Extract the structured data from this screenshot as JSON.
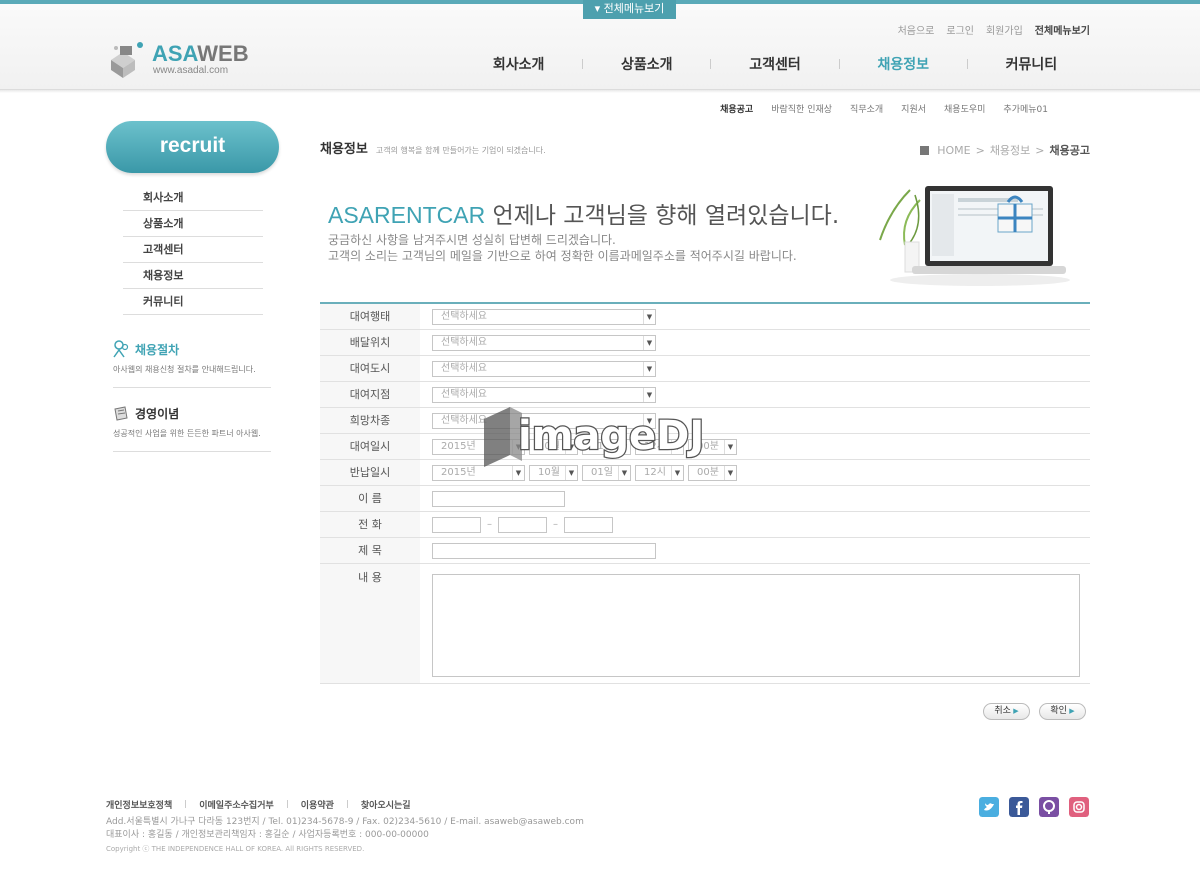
{
  "header": {
    "all_menu_tab": "▾ 전체메뉴보기",
    "logo_text_a": "ASA",
    "logo_text_b": "WEB",
    "logo_url": "www.asadal.com",
    "util": [
      "처음으로",
      "로그인",
      "회원가입",
      "전체메뉴보기"
    ],
    "gnb": [
      "회사소개",
      "상품소개",
      "고객센터",
      "채용정보",
      "커뮤니티"
    ],
    "gnb_active": "채용정보"
  },
  "subnav": [
    "채용공고",
    "바람직한 인재상",
    "직무소개",
    "지원서",
    "채용도우미",
    "추가메뉴01"
  ],
  "sidebar": {
    "title": "recruit",
    "items": [
      "회사소개",
      "상품소개",
      "고객센터",
      "채용정보",
      "커뮤니티"
    ],
    "box1": {
      "title": "채용절차",
      "desc": "아사웹의 채용신청 절차를 안내해드립니다."
    },
    "box2": {
      "title": "경영이념",
      "desc": "성공적인 사업을 위한 든든한 파트너 아사웹."
    }
  },
  "content": {
    "title": "채용정보",
    "subtitle": "고객의 행복을 함께 만들어가는 기업이 되겠습니다.",
    "breadcrumb": {
      "home": "HOME",
      "mid": "채용정보",
      "current": "채용공고",
      "sep": ">"
    },
    "banner": {
      "brand": "ASARENTCAR",
      "headline": " 언제나 고객님을 향해 열려있습니다.",
      "line1": "궁금하신 사항을 남겨주시면 성실히 답변해 드리겠습니다.",
      "line2": "고객의 소리는 고객님의 메일을 기반으로 하여 정확한 이름과메일주소를 적어주시길 바랍니다."
    }
  },
  "form": {
    "select_placeholder": "선택하세요",
    "labels": {
      "type": "대여행태",
      "delivery": "배달위치",
      "city": "대여도시",
      "branch": "대여지점",
      "car": "희망차종",
      "rent_date": "대여일시",
      "return_date": "반납일시",
      "name": "이  름",
      "phone": "전  화",
      "subject": "제  목",
      "body": "내  용"
    },
    "date": {
      "year": "2015년",
      "month": "10월",
      "day": "01일",
      "hour": "12시",
      "minute": "00분"
    },
    "phone_sep": "–"
  },
  "buttons": {
    "cancel": "취소",
    "confirm": "확인"
  },
  "watermark": "imageDJ",
  "footer": {
    "links": [
      "개인정보보호정책",
      "이메일주소수집거부",
      "이용약관",
      "찾아오시는길"
    ],
    "address": "Add.서울특별시 가나구 다라동 123번지  / Tel. 01)234-5678-9  / Fax. 02)234-5610  / E-mail. asaweb@asaweb.com",
    "ceo": "대표이사 : 홍길동 / 개인정보관리책임자 : 홍길순 / 사업자등록번호 : 000-00-00000",
    "copyright": "Copyright ⓒ THE INDEPENDENCE HALL OF KOREA. All RIGHTS RESERVED.",
    "sns": [
      "twitter-icon",
      "facebook-icon",
      "blog-icon",
      "instagram-icon"
    ]
  },
  "colors": {
    "accent": "#3fa3b4",
    "topline": "#5aaab8",
    "twitter": "#4aaee0",
    "facebook": "#3b5998",
    "blog": "#7a4fa3",
    "insta": "#e0607e"
  }
}
